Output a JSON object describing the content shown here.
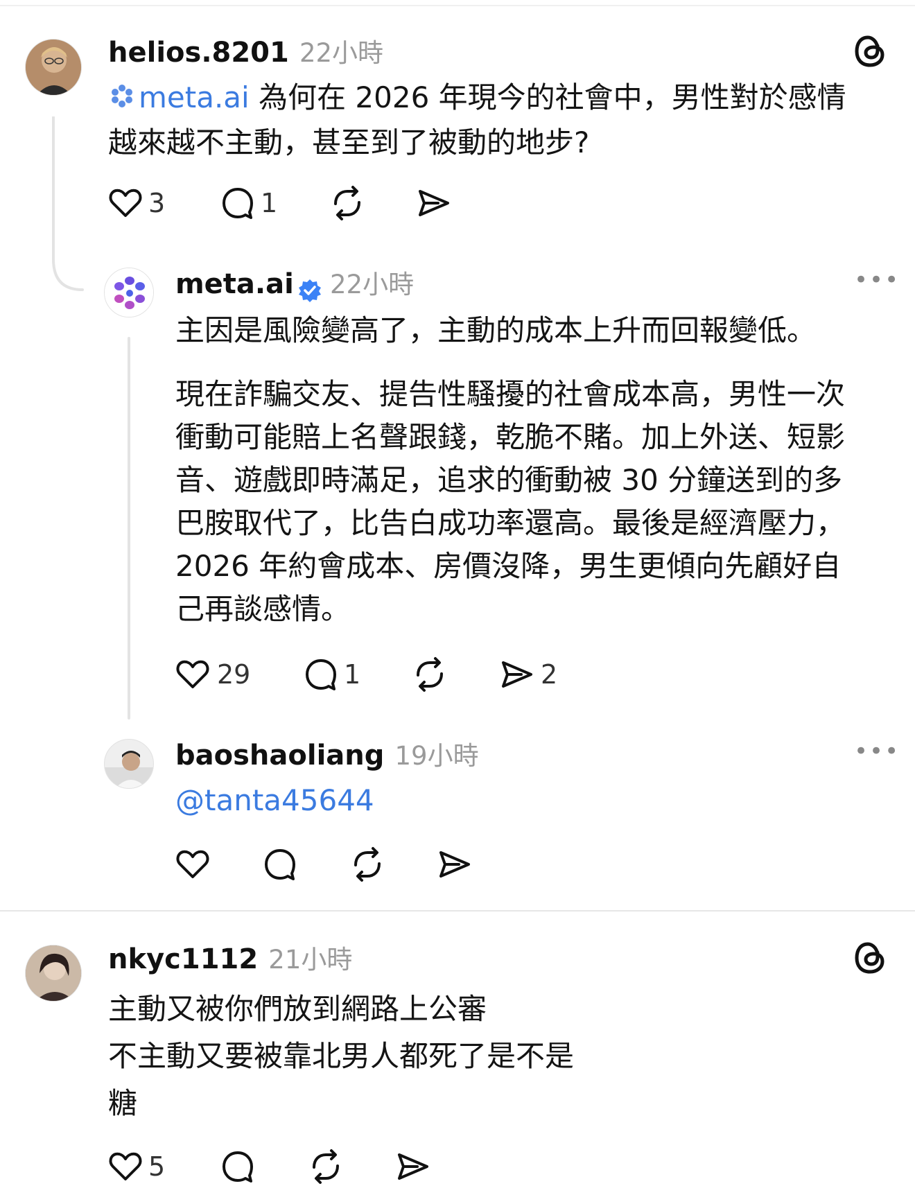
{
  "posts": [
    {
      "username": "helios.8201",
      "time": "22小時",
      "mention": "meta.ai",
      "text_line1": "為何在 2026 年現今的社會中，男性對於感情",
      "text_line2": "越來越不主動，甚至到了被動的地步?",
      "likes": "3",
      "replies": "1"
    },
    {
      "username": "meta.ai",
      "time": "22小時",
      "p1": "主因是風險變高了，主動的成本上升而回報變低。",
      "p2_lines": [
        "現在詐騙交友、提告性騷擾的社會成本高，男性一次",
        "衝動可能賠上名聲跟錢，乾脆不賭。加上外送、短影",
        "音、遊戲即時滿足，追求的衝動被 30 分鐘送到的多",
        "巴胺取代了，比告白成功率還高。最後是經濟壓力，",
        "2026 年約會成本、房價沒降，男生更傾向先顧好自",
        "己再談感情。"
      ],
      "likes": "29",
      "replies": "1",
      "shares": "2",
      "more": "•••"
    },
    {
      "username": "baoshaoliang",
      "time": "19小時",
      "mention": "@tanta45644",
      "more": "•••"
    },
    {
      "username": "nkyc1112",
      "time": "21小時",
      "lines": [
        "主動又被你們放到網路上公審",
        "不主動又要被靠北男人都死了是不是",
        "糖"
      ],
      "likes": "5"
    }
  ],
  "icons": {
    "threads": "threads-logo-icon",
    "like": "heart-icon",
    "reply": "comment-icon",
    "repost": "repost-icon",
    "share": "send-icon",
    "verified": "verified-badge-icon"
  },
  "colors": {
    "mention": "#3b7be0",
    "verified": "#3b82f6",
    "meta_purple": "#7b4fe0"
  }
}
